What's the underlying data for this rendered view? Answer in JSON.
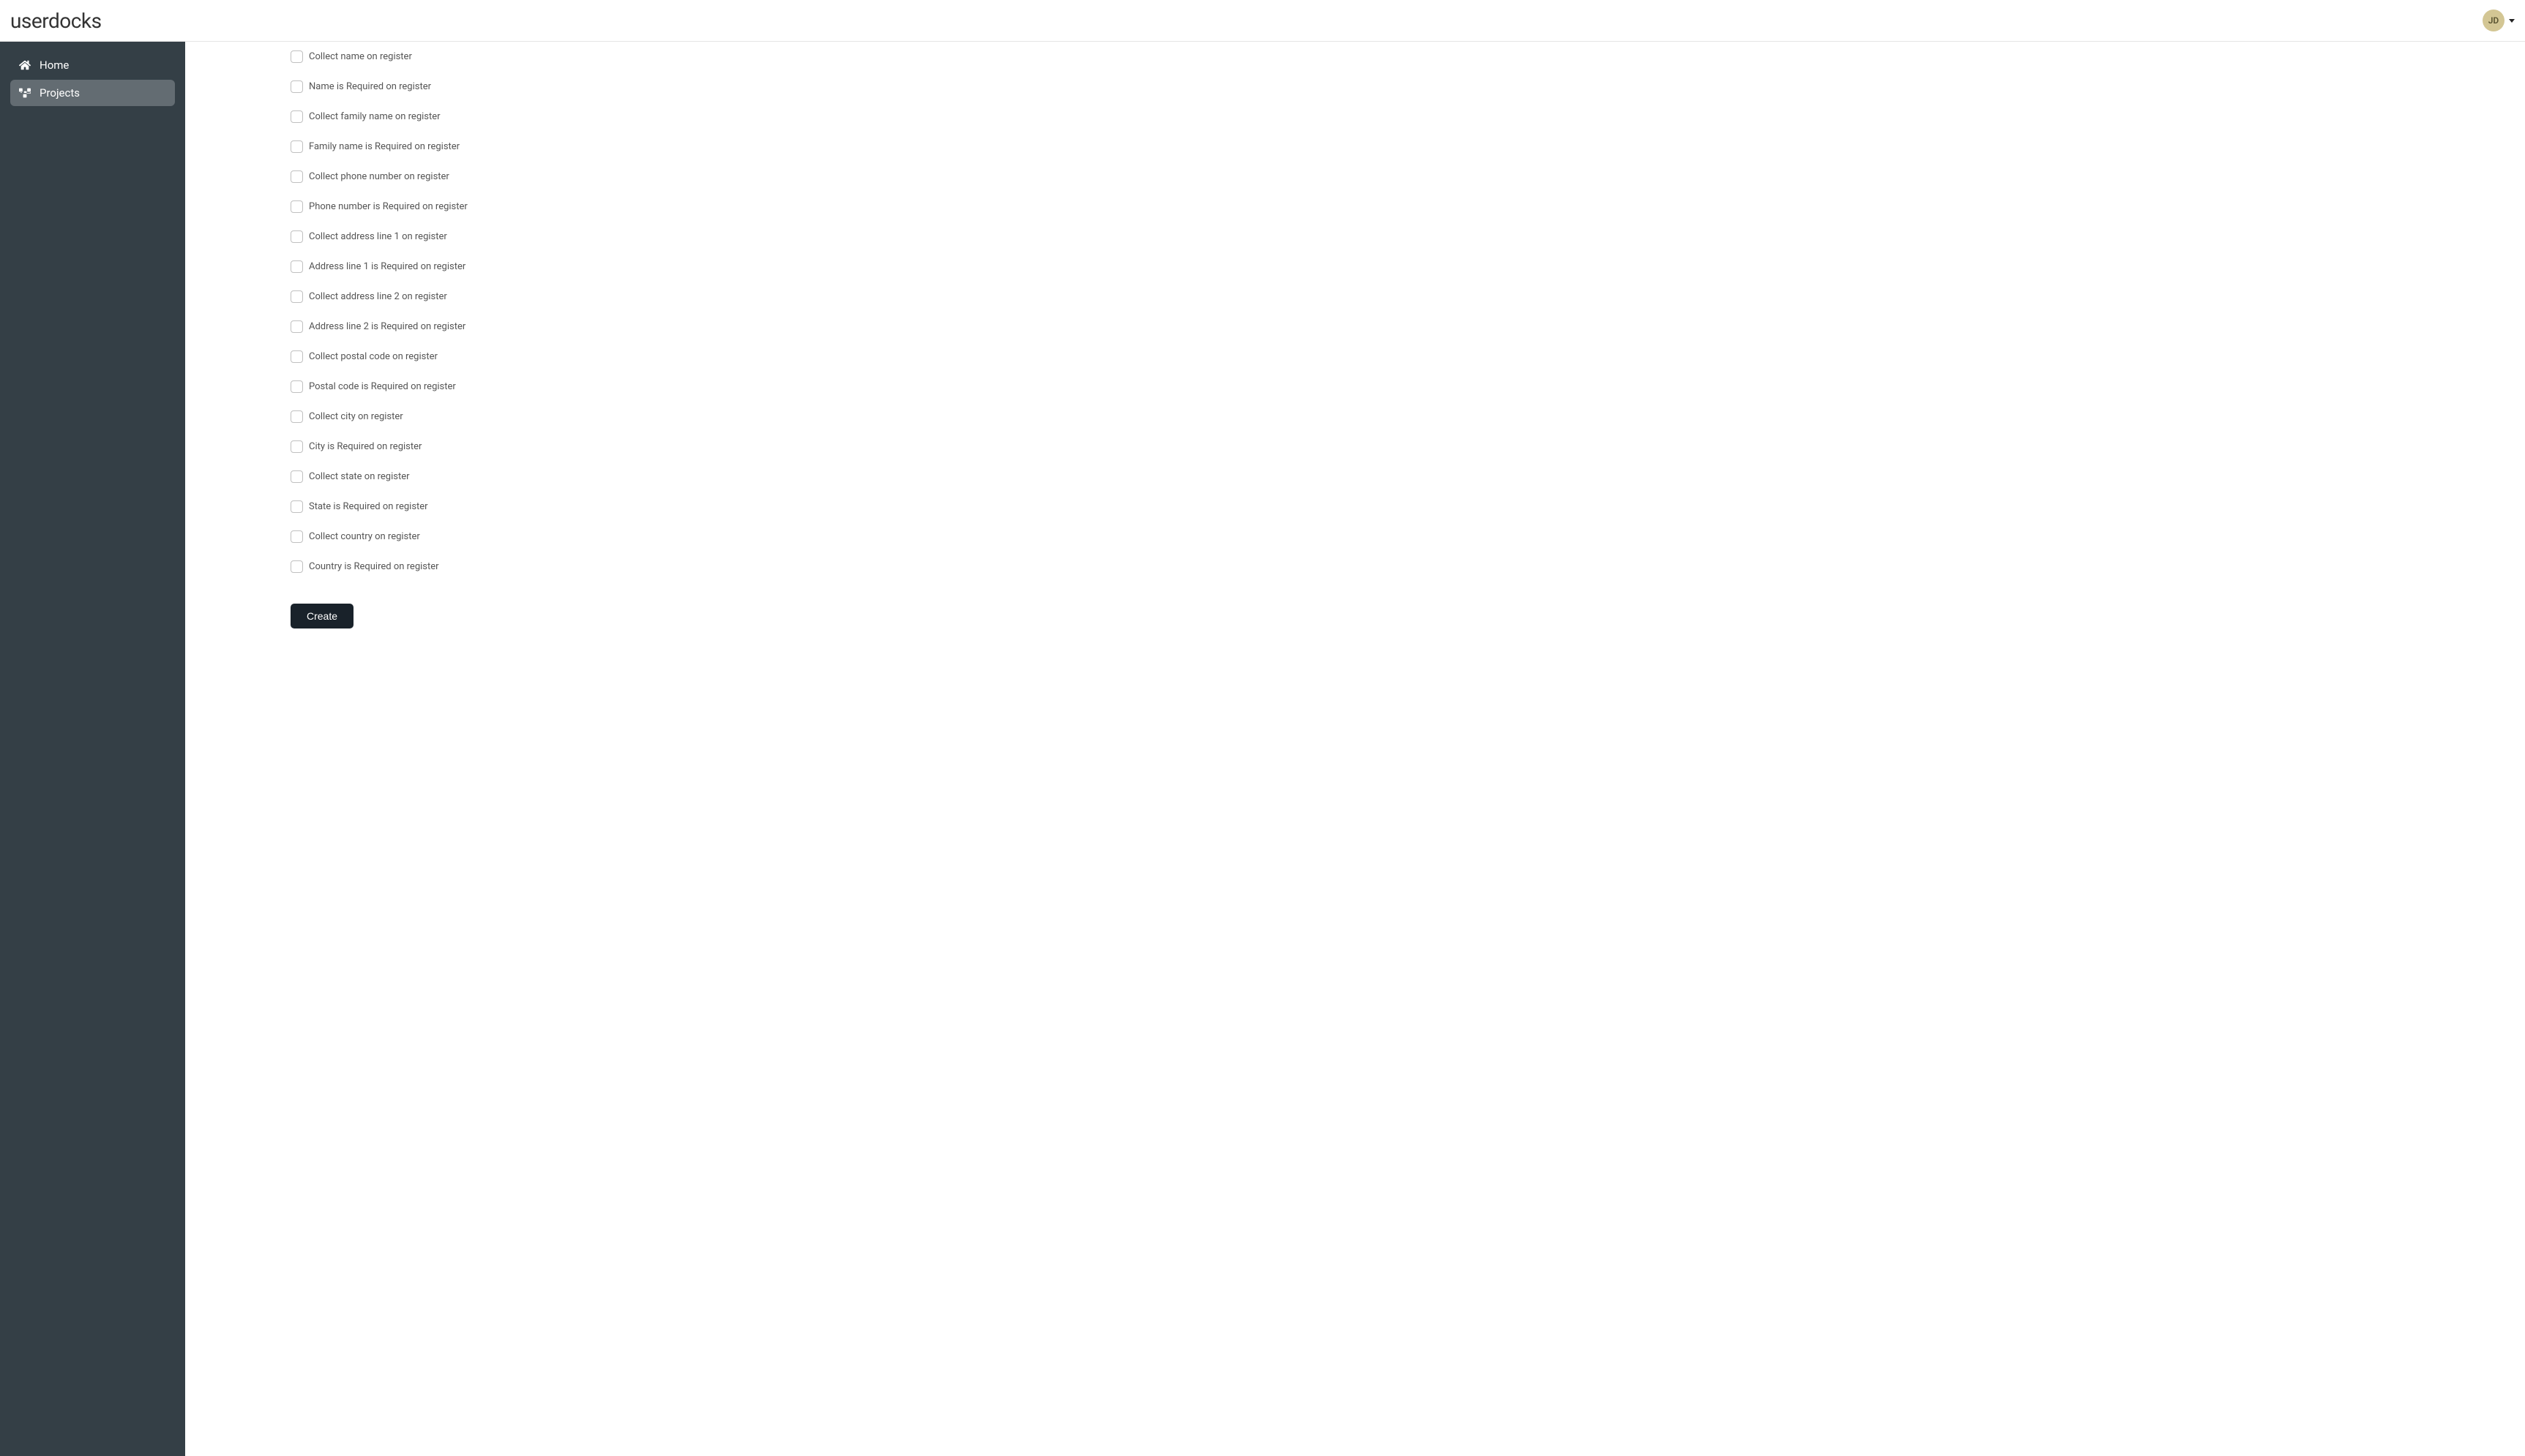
{
  "header": {
    "brand": "userdocks",
    "user_initials": "JD"
  },
  "sidebar": {
    "items": [
      {
        "id": "home",
        "label": "Home",
        "icon": "home-icon",
        "active": false
      },
      {
        "id": "projects",
        "label": "Projects",
        "icon": "projects-icon",
        "active": true
      }
    ]
  },
  "form": {
    "fields": [
      {
        "id": "collect_name",
        "label": "Collect name on register",
        "checked": false
      },
      {
        "id": "name_required",
        "label": "Name is Required on register",
        "checked": false
      },
      {
        "id": "collect_family_name",
        "label": "Collect family name on register",
        "checked": false
      },
      {
        "id": "family_name_required",
        "label": "Family name is Required on register",
        "checked": false
      },
      {
        "id": "collect_phone",
        "label": "Collect phone number on register",
        "checked": false
      },
      {
        "id": "phone_required",
        "label": "Phone number is Required on register",
        "checked": false
      },
      {
        "id": "collect_addr1",
        "label": "Collect address line 1 on register",
        "checked": false
      },
      {
        "id": "addr1_required",
        "label": "Address line 1 is Required on register",
        "checked": false
      },
      {
        "id": "collect_addr2",
        "label": "Collect address line 2 on register",
        "checked": false
      },
      {
        "id": "addr2_required",
        "label": "Address line 2 is Required on register",
        "checked": false
      },
      {
        "id": "collect_postal",
        "label": "Collect postal code on register",
        "checked": false
      },
      {
        "id": "postal_required",
        "label": "Postal code is Required on register",
        "checked": false
      },
      {
        "id": "collect_city",
        "label": "Collect city on register",
        "checked": false
      },
      {
        "id": "city_required",
        "label": "City is Required on register",
        "checked": false
      },
      {
        "id": "collect_state",
        "label": "Collect state on register",
        "checked": false
      },
      {
        "id": "state_required",
        "label": "State is Required on register",
        "checked": false
      },
      {
        "id": "collect_country",
        "label": "Collect country on register",
        "checked": false
      },
      {
        "id": "country_required",
        "label": "Country is Required on register",
        "checked": false
      }
    ],
    "submit_label": "Create"
  }
}
